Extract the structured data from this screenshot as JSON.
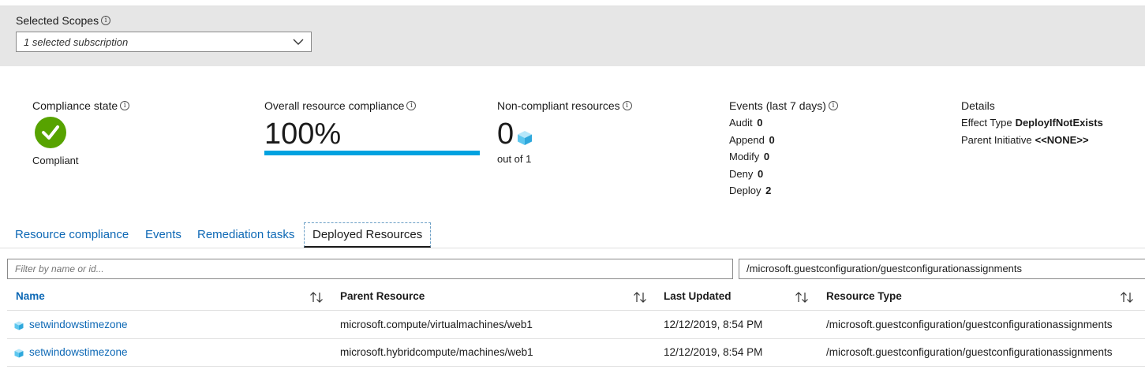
{
  "scopes": {
    "label": "Selected Scopes",
    "value": "1 selected subscription"
  },
  "summary": {
    "compliance_state": {
      "title": "Compliance state",
      "value": "Compliant",
      "icon": "checkmark-circle-icon",
      "color": "#57a300"
    },
    "overall": {
      "title": "Overall resource compliance",
      "value": "100%",
      "percent": 100,
      "bar_color": "#00a2e0"
    },
    "noncompliant": {
      "title": "Non-compliant resources",
      "count": "0",
      "out_of": "out of 1"
    },
    "events": {
      "title": "Events (last 7 days)",
      "items": [
        {
          "label": "Audit",
          "value": "0"
        },
        {
          "label": "Append",
          "value": "0"
        },
        {
          "label": "Modify",
          "value": "0"
        },
        {
          "label": "Deny",
          "value": "0"
        },
        {
          "label": "Deploy",
          "value": "2"
        }
      ]
    },
    "details": {
      "title": "Details",
      "effect_label": "Effect Type",
      "effect_value": "DeployIfNotExists",
      "initiative_label": "Parent Initiative",
      "initiative_value": "<<NONE>>"
    }
  },
  "tabs": [
    {
      "label": "Resource compliance"
    },
    {
      "label": "Events"
    },
    {
      "label": "Remediation tasks"
    },
    {
      "label": "Deployed Resources",
      "active": true
    }
  ],
  "filter": {
    "placeholder": "Filter by name or id...",
    "type_value": "/microsoft.guestconfiguration/guestconfigurationassignments"
  },
  "table": {
    "columns": [
      "Name",
      "Parent Resource",
      "Last Updated",
      "Resource Type"
    ],
    "rows": [
      {
        "name": "setwindowstimezone",
        "parent": "microsoft.compute/virtualmachines/web1",
        "updated": "12/12/2019, 8:54 PM",
        "type": "/microsoft.guestconfiguration/guestconfigurationassignments"
      },
      {
        "name": "setwindowstimezone",
        "parent": "microsoft.hybridcompute/machines/web1",
        "updated": "12/12/2019, 8:54 PM",
        "type": "/microsoft.guestconfiguration/guestconfigurationassignments"
      }
    ]
  },
  "colors": {
    "link": "#0d68b5",
    "accent": "#00a2e0",
    "success": "#57a300"
  }
}
